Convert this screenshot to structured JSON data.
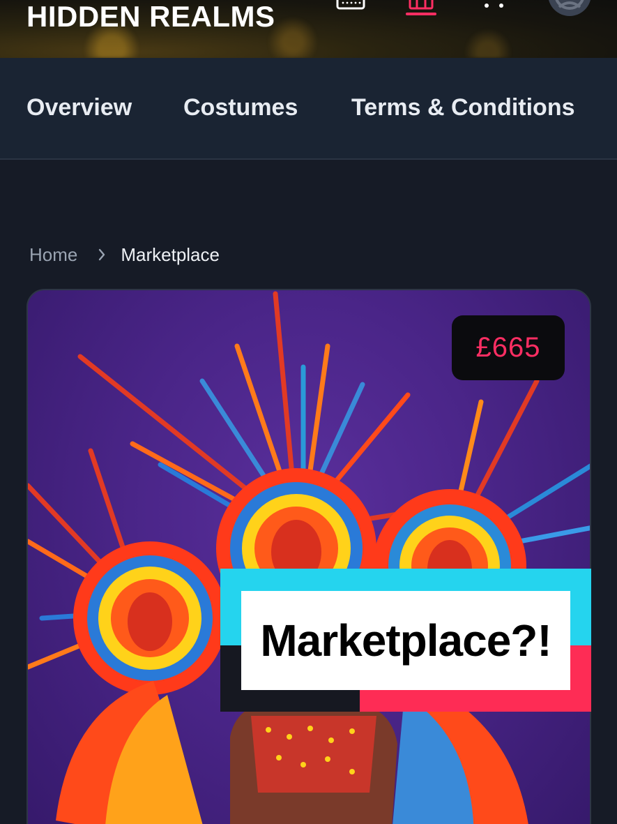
{
  "header": {
    "brand": "HIDDEN REALMS",
    "icons": [
      "keyboard-icon",
      "store-icon",
      "more-dots-icon",
      "avatar-icon"
    ],
    "active_icon_color": "#ff2e63"
  },
  "nav": {
    "tabs": [
      {
        "label": "Overview"
      },
      {
        "label": "Costumes"
      },
      {
        "label": "Terms & Conditions"
      }
    ]
  },
  "breadcrumb": {
    "home": "Home",
    "current": "Marketplace"
  },
  "product": {
    "price": "£665",
    "image_subject": "carnival-costume-photo"
  },
  "overlay": {
    "caption": "Marketplace?!",
    "colors": {
      "cyan": "#25d4ee",
      "pink": "#fe2c55",
      "dark": "#161821"
    }
  },
  "colors": {
    "page_bg": "#161b26",
    "nav_bg": "#1a2433",
    "accent": "#ff2e63"
  }
}
